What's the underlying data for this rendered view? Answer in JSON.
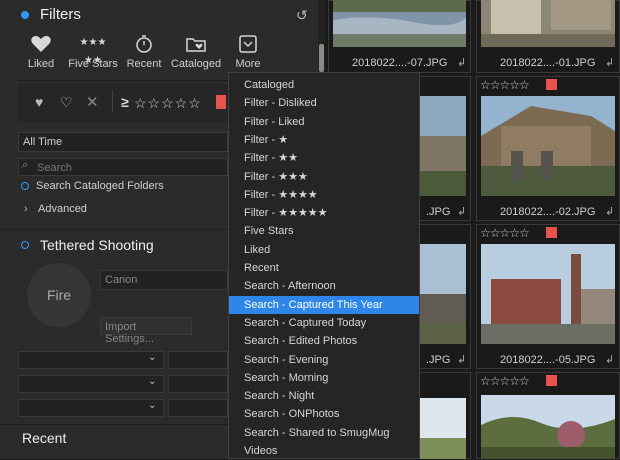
{
  "filters": {
    "title": "Filters",
    "buttons": [
      {
        "label": "Liked"
      },
      {
        "label": "Five Stars"
      },
      {
        "label": "Recent"
      },
      {
        "label": "Cataloged"
      },
      {
        "label": "More"
      }
    ],
    "rating_min_symbol": "≥",
    "time_select": "All Time",
    "search_placeholder": "Search",
    "search_cataloged": "Search Cataloged Folders",
    "advanced": "Advanced"
  },
  "tethered": {
    "title": "Tethered Shooting",
    "fire_label": "Fire",
    "camera_placeholder": "Canon",
    "import_settings": "Import Settings..."
  },
  "recent": {
    "title": "Recent"
  },
  "menu": {
    "items": [
      "Cataloged",
      "Filter - Disliked",
      "Filter - Liked",
      "Filter - ★",
      "Filter - ★★",
      "Filter - ★★★",
      "Filter - ★★★★",
      "Filter - ★★★★★",
      "Five Stars",
      "Liked",
      "Recent",
      "Search - Afternoon",
      "Search - Captured This Year",
      "Search - Captured Today",
      "Search - Edited Photos",
      "Search - Evening",
      "Search - Morning",
      "Search - Night",
      "Search - ONPhotos",
      "Search - Shared to SmugMug",
      "Videos"
    ],
    "selected_index": 12
  },
  "grid": {
    "captions": [
      "2018022....-07.JPG",
      "2018022....-01.JPG",
      ".JPG",
      "2018022....-02.JPG",
      ".JPG",
      "2018022....-05.JPG"
    ],
    "stars_text": "☆☆☆☆☆",
    "flag_color": "#e8534f"
  }
}
